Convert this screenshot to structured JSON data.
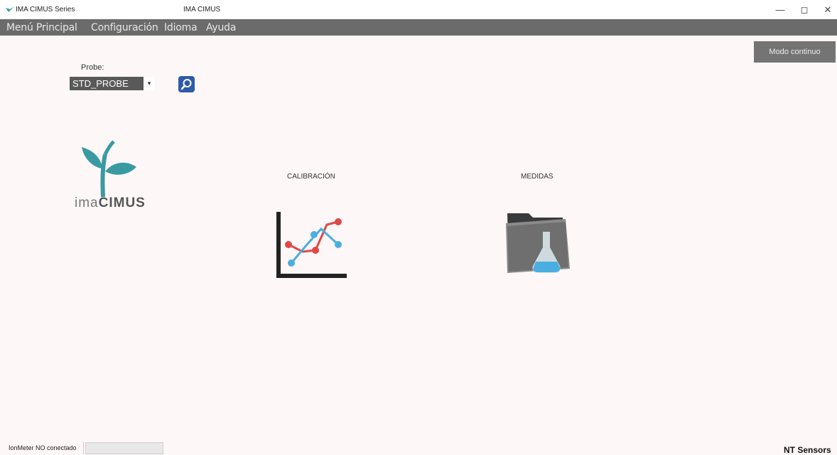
{
  "titlebar": {
    "app_title": "IMA CIMUS Series",
    "window_title": "IMA CIMUS",
    "minimize": "—",
    "maximize": "◻",
    "close": "✕"
  },
  "menu": {
    "items": [
      "Menú Principal",
      "Configuración",
      "Idioma",
      "Ayuda"
    ]
  },
  "toolbar": {
    "modo_label": "Modo continuo"
  },
  "probe": {
    "label": "Probe:",
    "selected": "STD_PROBE"
  },
  "logo": {
    "text_light": "ima",
    "text_bold": "CIMUS"
  },
  "main": {
    "calibracion_label": "CALIBRACIÓN",
    "medidas_label": "MEDIDAS"
  },
  "status": {
    "connection": "IonMeter NO conectado",
    "brand": "NT Sensors"
  },
  "colors": {
    "menubar": "#6b6b6b",
    "background": "#fdf7f7",
    "logo_teal": "#3a9aa3",
    "chart_red": "#e04848",
    "chart_blue": "#4aaee0"
  }
}
